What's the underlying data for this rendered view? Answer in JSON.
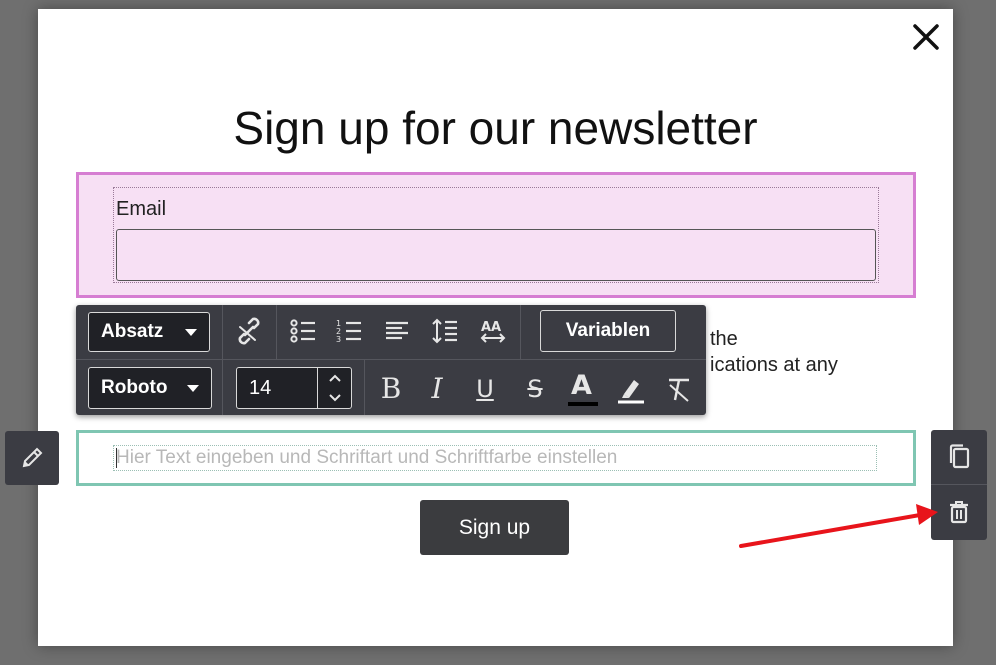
{
  "modal": {
    "title": "Sign up for our newsletter"
  },
  "email_field": {
    "label": "Email",
    "value": ""
  },
  "consent": {
    "line1": "the",
    "line2": "ications at any"
  },
  "toolbar": {
    "paragraph_select": "Absatz",
    "font_select": "Roboto",
    "font_size": "14",
    "variables_label": "Variablen",
    "icons": [
      "unlink-icon",
      "bulleted-list-icon",
      "numbered-list-icon",
      "align-left-icon",
      "line-height-icon",
      "letter-spacing-icon",
      "bold-icon",
      "italic-icon",
      "underline-icon",
      "strikethrough-icon",
      "text-color-icon",
      "highlight-icon",
      "clear-format-icon"
    ],
    "bold_glyph": "B",
    "italic_glyph": "I",
    "underline_glyph": "U",
    "strike_glyph": "S",
    "color_glyph": "A"
  },
  "text_block": {
    "placeholder": "Hier Text eingeben und Schriftart und Schriftfarbe einstellen"
  },
  "signup_button": {
    "label": "Sign up"
  },
  "colors": {
    "email_block_border": "#d67ed2",
    "email_block_bg": "#f7e0f4",
    "text_block_border": "#7fc6b2",
    "toolbar_bg": "#3b3c43",
    "annotation_arrow": "#e8141b"
  }
}
